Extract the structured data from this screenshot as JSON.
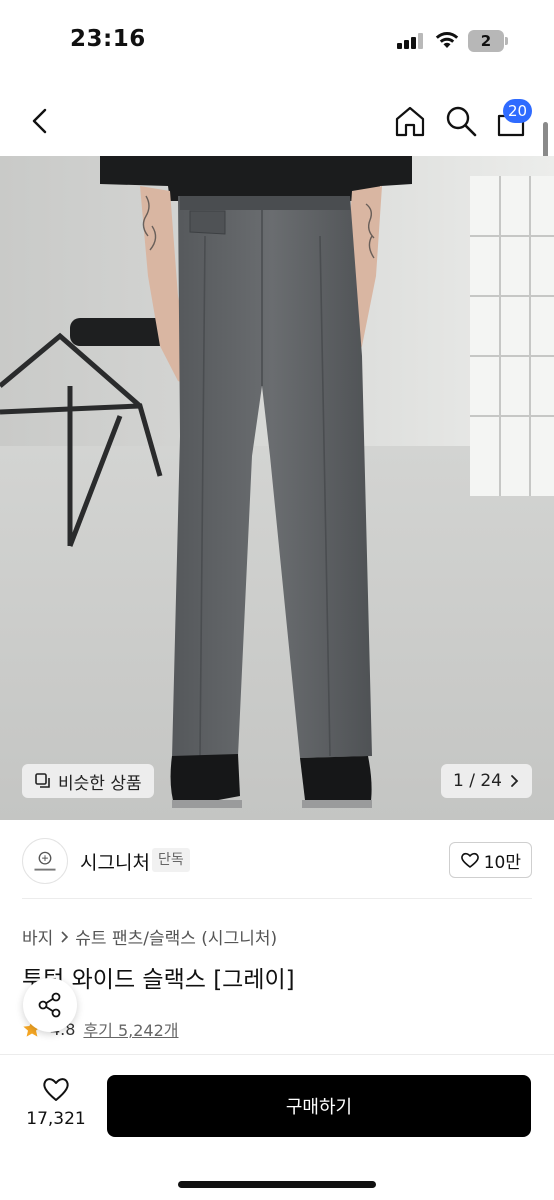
{
  "status_bar": {
    "time": "23:16",
    "battery": "2",
    "icons": [
      "signal-icon",
      "wifi-icon",
      "battery-icon"
    ]
  },
  "nav": {
    "icons": [
      "back-icon",
      "home-icon",
      "search-icon",
      "cart-icon"
    ],
    "cart_count": "20"
  },
  "image": {
    "similar_label": "비슷한 상품",
    "counter": "1 / 24"
  },
  "brand": {
    "name": "시그니처",
    "tag": "단독",
    "likes": "10만"
  },
  "product": {
    "breadcrumb": [
      "바지",
      "슈트 팬츠/슬랙스 (시그니처)"
    ],
    "title": "투턱 와이드 슬랙스 [그레이]",
    "rating": "4.8",
    "reviews": "후기 5,242개"
  },
  "bottom": {
    "wish_count": "17,321",
    "buy_label": "구매하기"
  },
  "colors": {
    "badge": "#2f6bff",
    "buy_button": "#000000",
    "star": "#f5a623"
  }
}
